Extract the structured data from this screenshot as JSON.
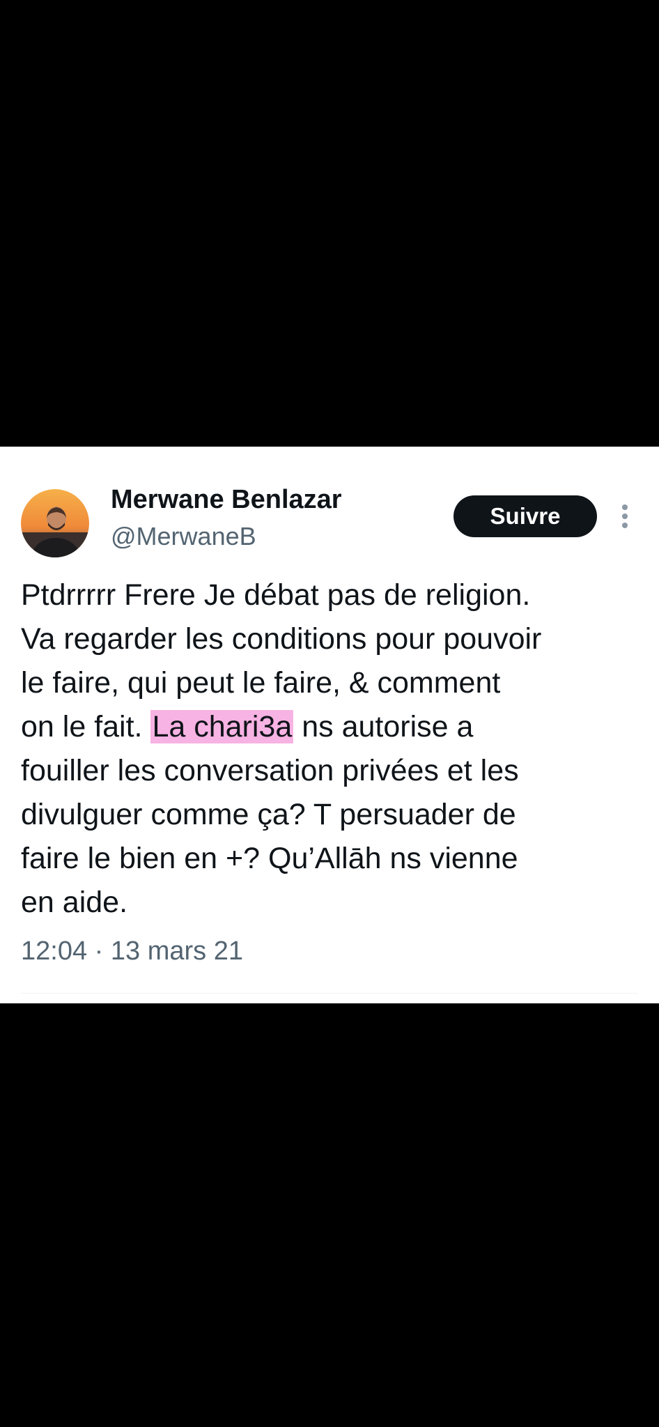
{
  "tweet": {
    "author": {
      "display_name": "Merwane Benlazar",
      "handle": "@MerwaneB",
      "avatar_icon": "profile-photo"
    },
    "follow_label": "Suivre",
    "more_icon": "vertical-ellipsis-icon",
    "text_lines": [
      "Ptdrrrrr Frere Je débat pas de religion.",
      "Va regarder les conditions pour pouvoir",
      "le faire, qui peut le faire, & comment",
      "on le fait.",
      "La chari3a",
      "ns autorise a",
      "fouiller les conversation privées et les",
      "divulguer comme ça? T persuader de",
      "faire le bien en +? Qu’Allāh ns vienne",
      "en aide."
    ],
    "highlight_color": "#f7b3e3",
    "timestamp": "12:04 · 13 mars 21"
  },
  "colors": {
    "background_outer": "#000000",
    "card": "#ffffff",
    "primary_text": "#0f1419",
    "secondary_text": "#536471",
    "button_bg": "#0f1419"
  }
}
